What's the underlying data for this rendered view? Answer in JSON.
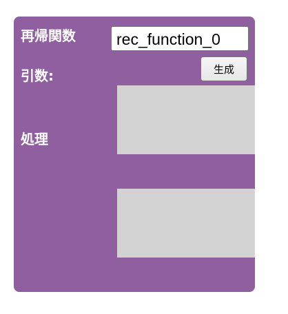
{
  "block": {
    "title_label": "再帰関数",
    "function_name_value": "rec_function_0",
    "generate_button_label": "生成",
    "args_label": "引数:",
    "body_label": "処理"
  },
  "colors": {
    "block_background": "#8f5f9f",
    "slot_background": "#d3d3d3",
    "label_text": "#ffffff"
  }
}
